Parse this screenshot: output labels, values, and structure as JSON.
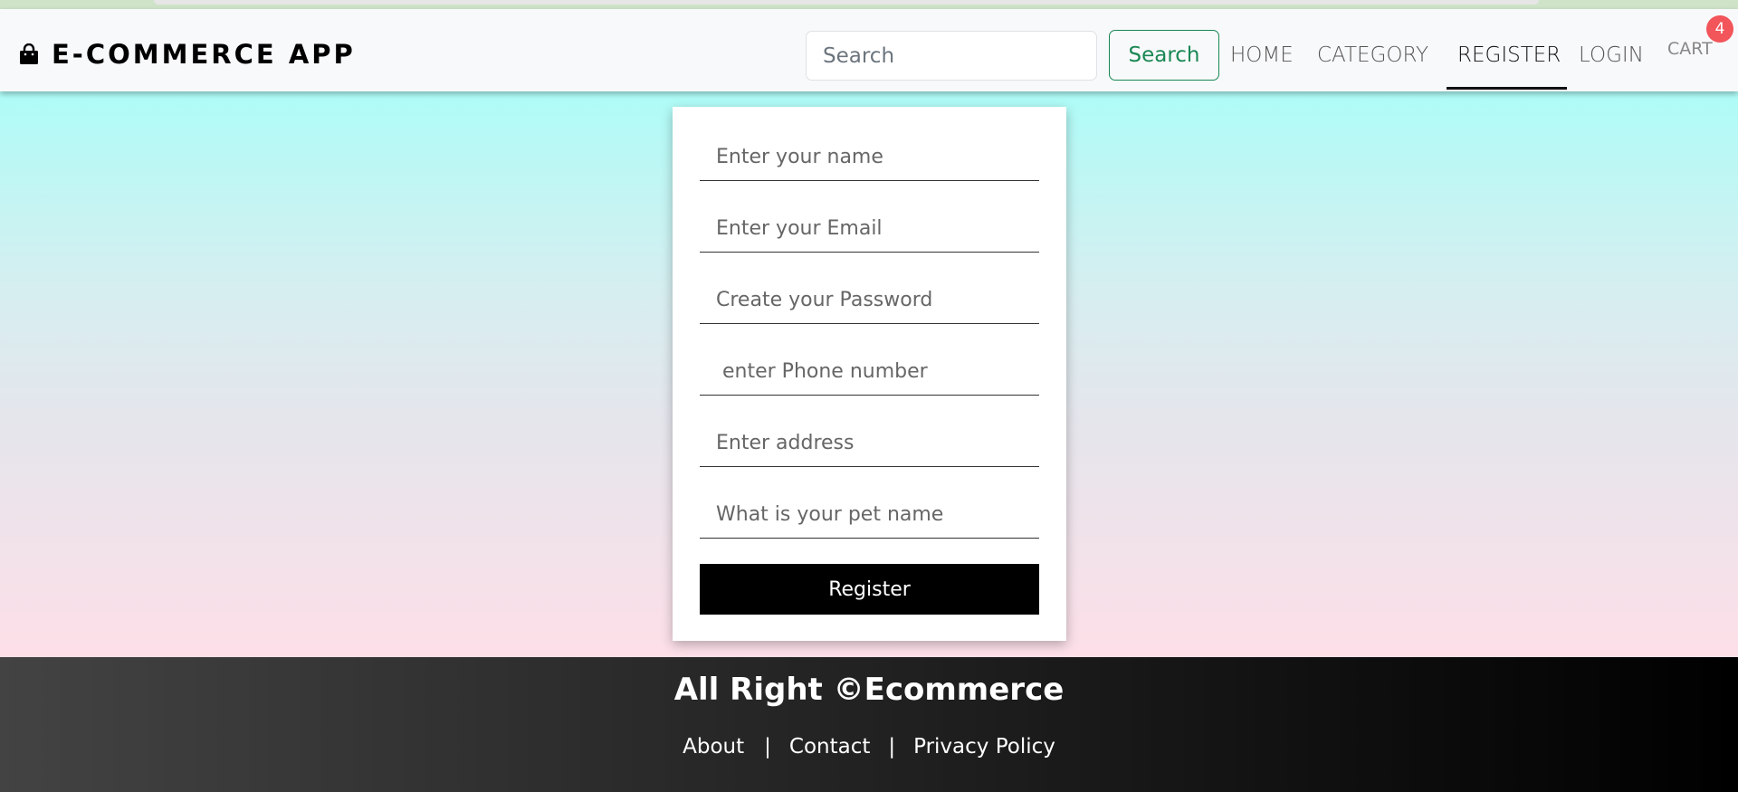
{
  "header": {
    "brand": {
      "icon": "shopping-bag-icon",
      "title": "E-COMMERCE APP"
    },
    "search": {
      "placeholder": "Search",
      "button_label": "Search"
    },
    "nav": [
      {
        "label": "HOME",
        "active": false
      },
      {
        "label": "CATEGORY",
        "active": false
      },
      {
        "label": "REGISTER",
        "active": true
      },
      {
        "label": "LOGIN",
        "active": false
      }
    ],
    "cart": {
      "label": "CART",
      "count": "4"
    }
  },
  "form": {
    "fields": [
      {
        "placeholder": "Enter your name",
        "value": ""
      },
      {
        "placeholder": "Enter your Email",
        "value": ""
      },
      {
        "placeholder": "Create your Password",
        "value": ""
      },
      {
        "placeholder": " enter Phone number",
        "value": ""
      },
      {
        "placeholder": "Enter address",
        "value": ""
      },
      {
        "placeholder": "What is your pet name",
        "value": ""
      }
    ],
    "submit_label": "Register"
  },
  "footer": {
    "title": "All Right ©Ecommerce",
    "links": [
      "About",
      "Contact",
      "Privacy Policy"
    ],
    "separator": "|"
  },
  "colors": {
    "accent_green": "#198754",
    "badge_red": "#f2555a",
    "button_black": "#000000"
  }
}
